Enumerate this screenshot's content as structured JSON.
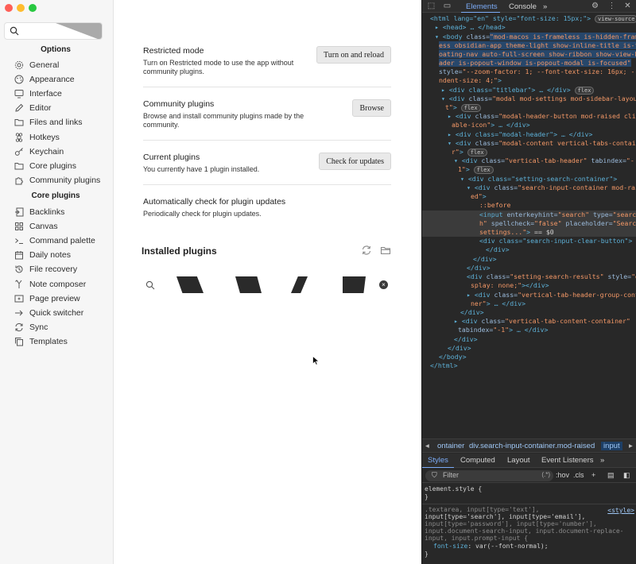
{
  "sidebar": {
    "search_placeholder": "",
    "options_heading": "Options",
    "core_heading": "Core plugins",
    "options_items": [
      {
        "label": "General",
        "icon": "gear-icon"
      },
      {
        "label": "Appearance",
        "icon": "palette-icon"
      },
      {
        "label": "Interface",
        "icon": "monitor-icon"
      },
      {
        "label": "Editor",
        "icon": "pencil-icon"
      },
      {
        "label": "Files and links",
        "icon": "folder-icon"
      },
      {
        "label": "Hotkeys",
        "icon": "command-icon"
      },
      {
        "label": "Keychain",
        "icon": "key-icon"
      },
      {
        "label": "Core plugins",
        "icon": "folder-icon"
      },
      {
        "label": "Community plugins",
        "icon": "puzzle-icon"
      }
    ],
    "core_items": [
      {
        "label": "Backlinks",
        "icon": "backlinks-icon"
      },
      {
        "label": "Canvas",
        "icon": "grid-icon"
      },
      {
        "label": "Command palette",
        "icon": "terminal-icon"
      },
      {
        "label": "Daily notes",
        "icon": "calendar-icon"
      },
      {
        "label": "File recovery",
        "icon": "history-icon"
      },
      {
        "label": "Note composer",
        "icon": "merge-icon"
      },
      {
        "label": "Page preview",
        "icon": "preview-icon"
      },
      {
        "label": "Quick switcher",
        "icon": "switch-icon"
      },
      {
        "label": "Sync",
        "icon": "sync-icon"
      },
      {
        "label": "Templates",
        "icon": "copy-icon"
      }
    ]
  },
  "content": {
    "settings": [
      {
        "name": "Restricted mode",
        "desc": "Turn on Restricted mode to use the app without community plugins.",
        "button": "Turn on and reload"
      },
      {
        "name": "Community plugins",
        "desc": "Browse and install community plugins made by the community.",
        "button": "Browse"
      },
      {
        "name": "Current plugins",
        "desc": "You currently have 1 plugin installed.",
        "button": "Check for updates"
      },
      {
        "name": "Automatically check for plugin updates",
        "desc": "Periodically check for plugin updates.",
        "button": ""
      }
    ],
    "installed_title": "Installed plugins",
    "clear_glyph": "×"
  },
  "devtools": {
    "tabs": {
      "elements": "Elements",
      "console": "Console",
      "more": "»"
    },
    "dom_lines": [
      "<html lang=\"en\" style=\"font-size: 15px;\">",
      "<head> … </head>",
      "<body class=\"mod-macos is-frameless is-hidden-frameless obsidian-app theme-light show-inline-title is-floating-nav auto-full-screen show-ribbon show-view-header is-popout-window is-popout-modal is-focused\"",
      "style=\"--zoom-factor: 1; --font-text-size: 16px; --indent-size: 4;\">",
      "<div class=\"titlebar\"> … </div>",
      "<div class=\"modal mod-settings mod-sidebar-layout\">",
      "<div class=\"modal-header-button mod-raised clickable-icon\"> … </div>",
      "<div class=\"modal-header\"> … </div>",
      "<div class=\"modal-content vertical-tabs-container\">",
      "<div class=\"vertical-tab-header\" tabindex=\"-1\">",
      "<div class=\"setting-search-container\">",
      "<div class=\"search-input-container mod-raised\">",
      "::before",
      "<input enterkeyhint=\"search\" type=\"search\" spellcheck=\"false\" placeholder=\"Search settings...\"> == $0",
      "<div class=\"search-input-clear-button\">",
      "</div>",
      "</div>",
      "</div>",
      "<div class=\"setting-search-results\" style=\"display: none;\"></div>",
      "<div class=\"vertical-tab-header-group-container\"> … </div>",
      "</div>",
      "<div class=\"vertical-tab-content-container\" tabindex=\"-1\"> … </div>",
      "</div>",
      "</div>",
      "</body>",
      "</html>"
    ],
    "view_source": "view-source",
    "flex_badge": "flex",
    "crumbs": {
      "first": "ontainer",
      "second": "div.search-input-container.mod-raised",
      "third": "input"
    },
    "sub_tabs": {
      "styles": "Styles",
      "computed": "Computed",
      "layout": "Layout",
      "listeners": "Event Listeners",
      "more": "»"
    },
    "filter": {
      "placeholder": "Filter",
      "regex": "(.*)",
      "hov": ":hov",
      "cls": ".cls"
    },
    "styles": {
      "element_style": "element.style {",
      "close": "}",
      "rule_selector_1": ".textarea, input[type='text'],",
      "rule_selector_2": "input[type='search'], input[type='email'],",
      "rule_selector_3": "input[type='password'], input[type='number'],",
      "rule_selector_4": "input.document-search-input, input.document-replace-",
      "rule_selector_5": "input, input.prompt-input {",
      "rule_prop": "font-size",
      "rule_val": "var(--font-normal);",
      "source": "<style>"
    }
  }
}
